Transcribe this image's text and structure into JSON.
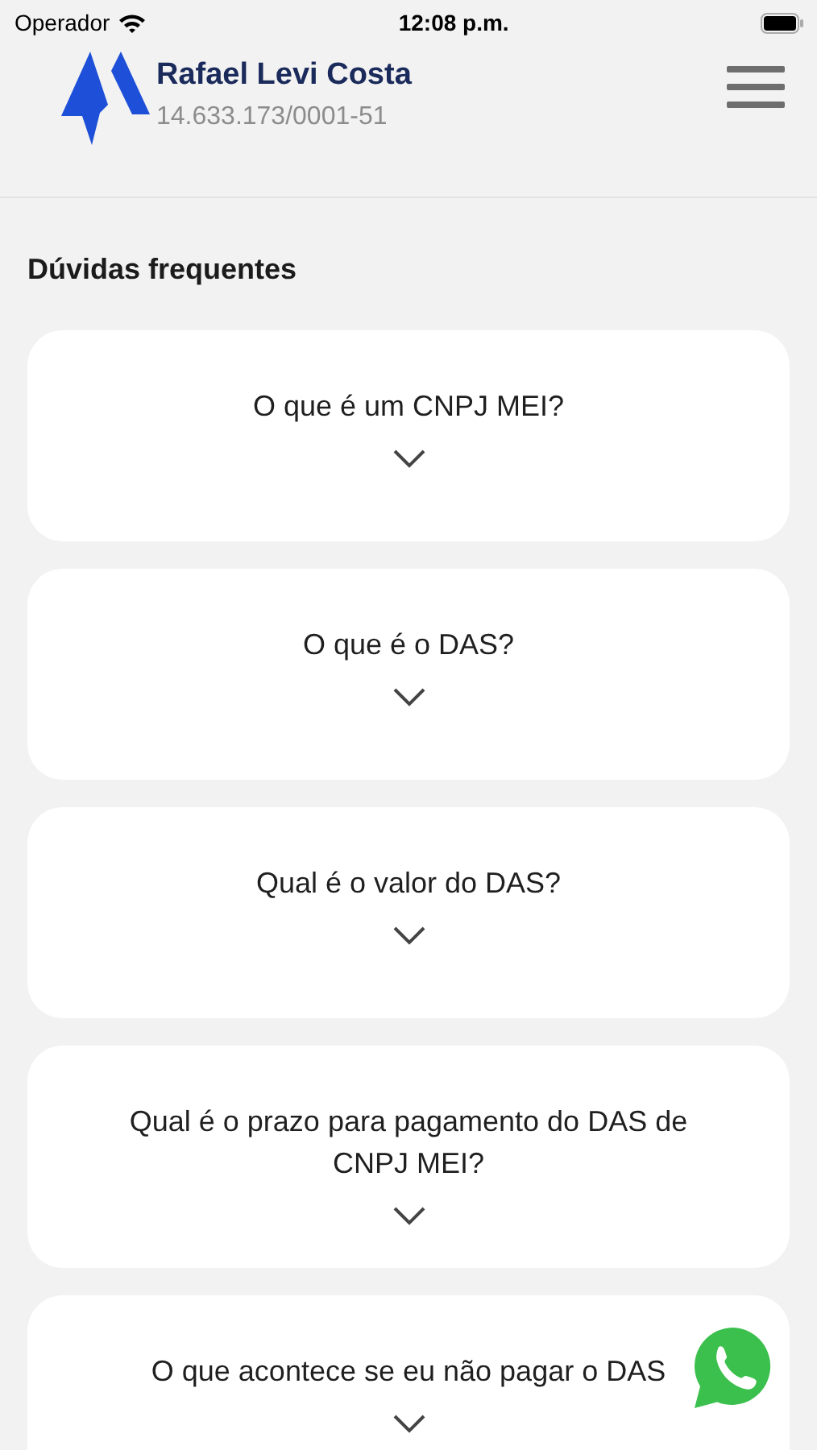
{
  "status_bar": {
    "carrier": "Operador",
    "time": "12:08 p.m."
  },
  "header": {
    "name": "Rafael Levi Costa",
    "document": "14.633.173/0001-51"
  },
  "faq": {
    "title": "Dúvidas frequentes",
    "items": [
      {
        "question": "O que é um CNPJ MEI?",
        "expanded": false
      },
      {
        "question": "O que é o DAS?",
        "expanded": false
      },
      {
        "question": "Qual é o valor do DAS?",
        "expanded": false
      },
      {
        "question": "Qual é o prazo para pagamento do DAS de CNPJ MEI?",
        "expanded": false
      },
      {
        "question": "O que acontece se eu não pagar o DAS",
        "expanded": false
      }
    ]
  }
}
